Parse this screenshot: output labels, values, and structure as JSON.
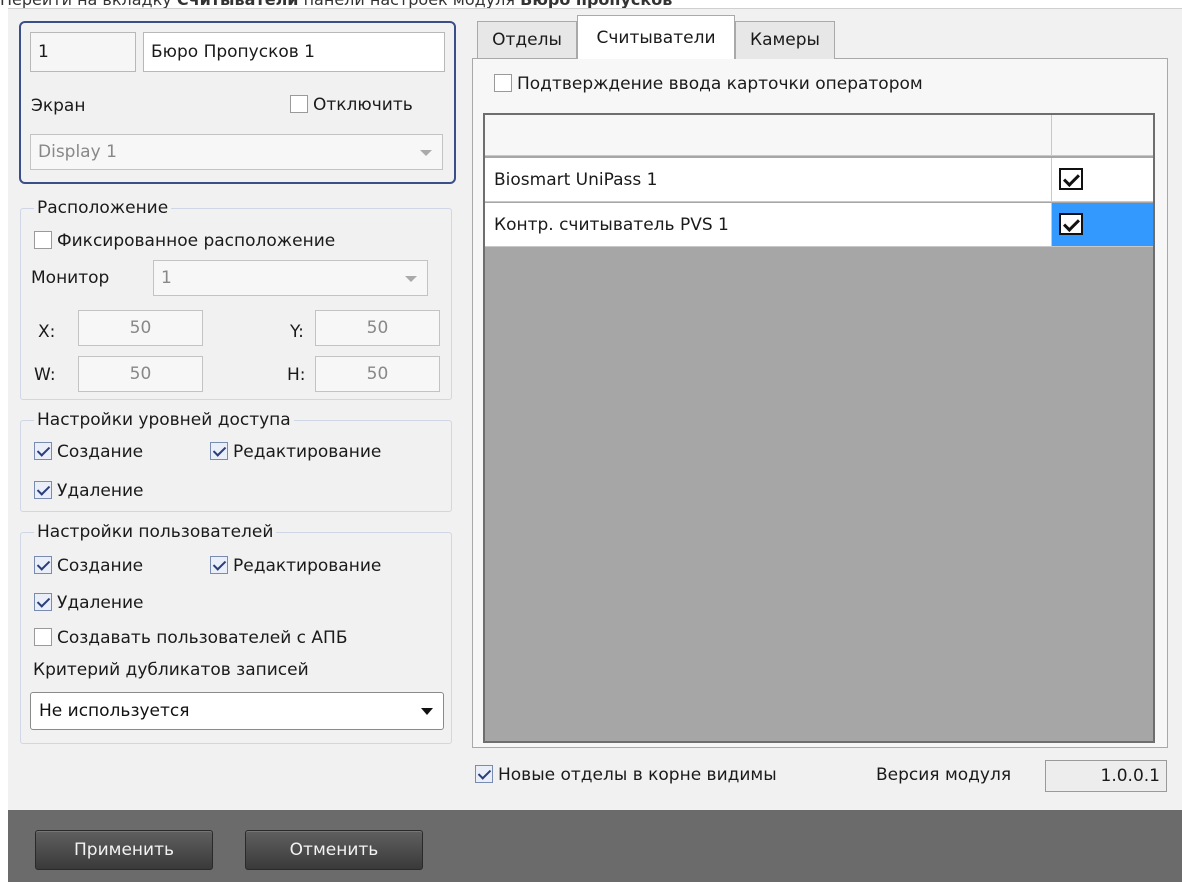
{
  "caption": {
    "prefix": "Перейти на вкладку ",
    "tab_name": "Считыватели",
    "middle": " панели настроек модуля ",
    "module_name": "Бюро пропусков"
  },
  "header": {
    "id_value": "1",
    "name_value": "Бюро Пропусков 1",
    "screen_label": "Экран",
    "disable_label": "Отключить",
    "disable_checked": false,
    "display_value": "Display 1"
  },
  "location": {
    "title": "Расположение",
    "fixed_label": "Фиксированное расположение",
    "fixed_checked": false,
    "monitor_label": "Монитор",
    "monitor_value": "1",
    "x_label": "X:",
    "x_value": "50",
    "y_label": "Y:",
    "y_value": "50",
    "w_label": "W:",
    "w_value": "50",
    "h_label": "H:",
    "h_value": "50"
  },
  "access_levels": {
    "title": "Настройки уровней доступа",
    "create_label": "Создание",
    "create_checked": true,
    "edit_label": "Редактирование",
    "edit_checked": true,
    "delete_label": "Удаление",
    "delete_checked": true
  },
  "users": {
    "title": "Настройки пользователей",
    "create_label": "Создание",
    "create_checked": true,
    "edit_label": "Редактирование",
    "edit_checked": true,
    "delete_label": "Удаление",
    "delete_checked": true,
    "apb_label": "Создавать пользователей с АПБ",
    "apb_checked": false,
    "dup_criteria_label": "Критерий дубликатов записей",
    "dup_criteria_value": "Не используется"
  },
  "tabs": [
    {
      "label": "Отделы",
      "active": false
    },
    {
      "label": "Считыватели",
      "active": true
    },
    {
      "label": "Камеры",
      "active": false
    }
  ],
  "readers": {
    "confirm_label": "Подтверждение ввода карточки оператором",
    "confirm_checked": false,
    "rows": [
      {
        "name": "Biosmart UniPass 1",
        "checked": true,
        "selected": false
      },
      {
        "name": "Контр. считыватель PVS 1",
        "checked": true,
        "selected": true
      }
    ]
  },
  "footer": {
    "new_depts_label": "Новые отделы в корне видимы",
    "new_depts_checked": true,
    "version_label": "Версия модуля",
    "version_value": "1.0.0.1",
    "apply_label": "Применить",
    "cancel_label": "Отменить"
  },
  "colors": {
    "accent_border": "#3a4f8a",
    "selection": "#3399ff",
    "bottom_bar": "#6b6b6b"
  }
}
